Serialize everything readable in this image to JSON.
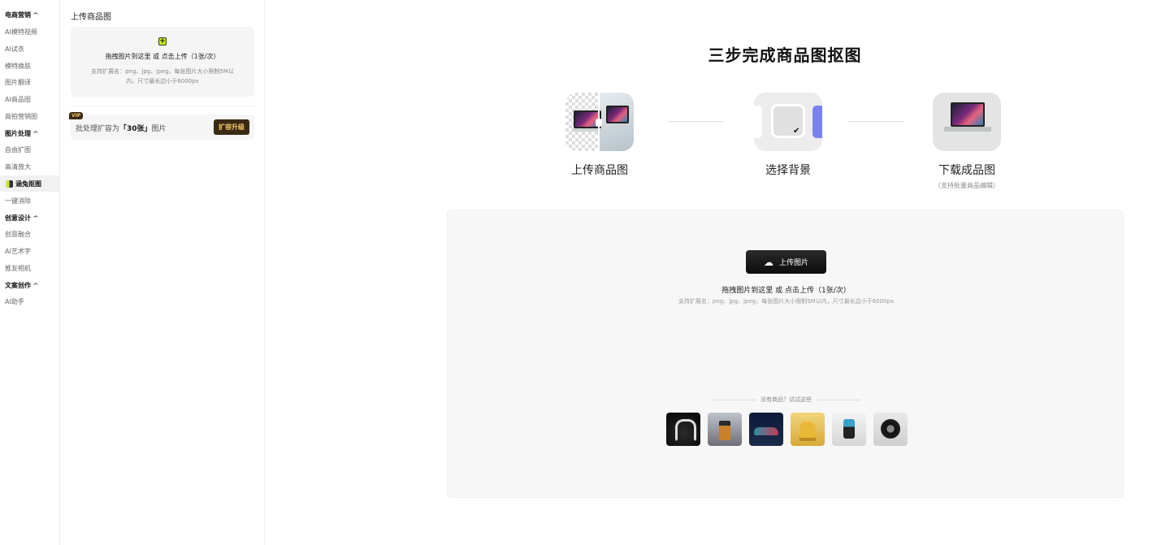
{
  "nav": {
    "groups": [
      {
        "label": "电商营销",
        "items": [
          "AI模特视频",
          "AI试衣",
          "模特换肤",
          "图片翻译",
          "AI商品图",
          "商拍营销图"
        ]
      },
      {
        "label": "图片处理",
        "items": [
          "自由扩图",
          "高清放大",
          "涵兔抠图",
          "一键消除"
        ]
      },
      {
        "label": "创意设计",
        "items": [
          "创意融合",
          "AI艺术字",
          "推友相机"
        ]
      },
      {
        "label": "文案创作",
        "items": [
          "AI助手"
        ]
      }
    ]
  },
  "panel": {
    "title": "上传商品图",
    "dropzone_main": "拖拽图片到这里 或 点击上传（1张/次）",
    "dropzone_hint": "支持扩展名：png、jpg、jpeg，每张图片大小限制5M以内，尺寸最长边小于6000px",
    "vip_badge": "VIP",
    "batch_prefix": "批处理扩容为",
    "batch_highlight": "「30张」",
    "batch_suffix": "图片",
    "upgrade_button": "扩容升级"
  },
  "main": {
    "title": "三步完成商品图抠图",
    "steps": [
      {
        "label": "上传商品图",
        "sub": ""
      },
      {
        "label": "选择背景",
        "sub": ""
      },
      {
        "label": "下载成品图",
        "sub": "（支持批量商品编辑）"
      }
    ],
    "upload_button": "上传图片",
    "upload_main": "拖拽图片到这里 或 点击上传（1张/次）",
    "upload_hint": "支持扩展名：png、jpg、jpeg，每张图片大小限制5M以内，尺寸最长边小于6000px",
    "try_label": "没有商品？试试这些",
    "samples": [
      "headphones",
      "perfume",
      "sneaker",
      "chair",
      "drill",
      "tire"
    ]
  },
  "colors": {
    "accent_dark": "#1a1a1a",
    "vip_gold": "#f1c56a",
    "vip_brown": "#3a2a14",
    "icon_lime": "#c6ef1e",
    "bg_blue": "#7b82f0"
  },
  "icons": {
    "nav_chevron": "chevron-up-icon",
    "upload": "cloud-upload-icon",
    "check": "check-icon",
    "plus": "plus-icon"
  }
}
